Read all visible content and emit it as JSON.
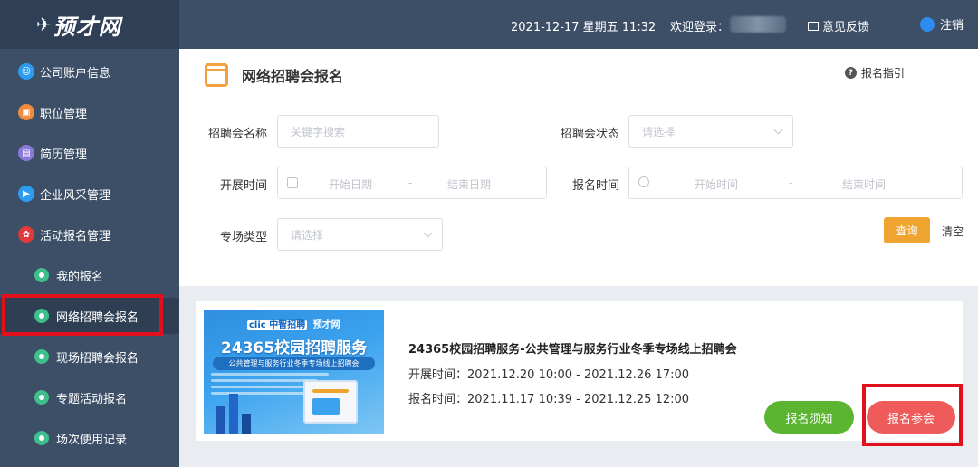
{
  "app": {
    "logo_text": "预才网"
  },
  "topbar": {
    "datetime": "2021-12-17 星期五 11:32",
    "welcome": "欢迎登录：",
    "feedback": "意见反馈",
    "logout": "注销"
  },
  "sidebar": {
    "items": [
      {
        "label": "公司账户信息",
        "icon": "account-icon",
        "color": "#2d9cf0"
      },
      {
        "label": "职位管理",
        "icon": "briefcase-icon",
        "color": "#f08a3c"
      },
      {
        "label": "简历管理",
        "icon": "resume-icon",
        "color": "#8a7ad8"
      },
      {
        "label": "企业风采管理",
        "icon": "play-icon",
        "color": "#2d9cf0"
      },
      {
        "label": "活动报名管理",
        "icon": "activity-icon",
        "color": "#e03a3a"
      }
    ],
    "sub_items": [
      {
        "label": "我的报名"
      },
      {
        "label": "网络招聘会报名"
      },
      {
        "label": "现场招聘会报名"
      },
      {
        "label": "专题活动报名"
      },
      {
        "label": "场次使用记录"
      }
    ]
  },
  "page": {
    "title": "网络招聘会报名",
    "guide": "报名指引"
  },
  "filters": {
    "name_label": "招聘会名称",
    "name_placeholder": "关键字搜索",
    "status_label": "招聘会状态",
    "status_placeholder": "请选择",
    "hold_time_label": "开展时间",
    "hold_start_placeholder": "开始日期",
    "hold_end_placeholder": "结束日期",
    "reg_time_label": "报名时间",
    "reg_start_placeholder": "开始时间",
    "reg_end_placeholder": "结束时间",
    "range_sep": "-",
    "type_label": "专场类型",
    "type_placeholder": "请选择",
    "query_button": "查询",
    "clear_button": "清空"
  },
  "card": {
    "banner_logo_1": "clic 中智招聘",
    "banner_logo_2": "预才网",
    "banner_title": "24365校园招聘服务",
    "banner_subtitle": "公共管理与服务行业冬季专场线上招聘会",
    "title": "24365校园招聘服务-公共管理与服务行业冬季专场线上招聘会",
    "hold_time": "开展时间：2021.12.20 10:00 - 2021.12.26 17:00",
    "reg_time": "报名时间：2021.11.17 10:39 - 2021.12.25 12:00",
    "notice_button": "报名须知",
    "apply_button": "报名参会"
  }
}
